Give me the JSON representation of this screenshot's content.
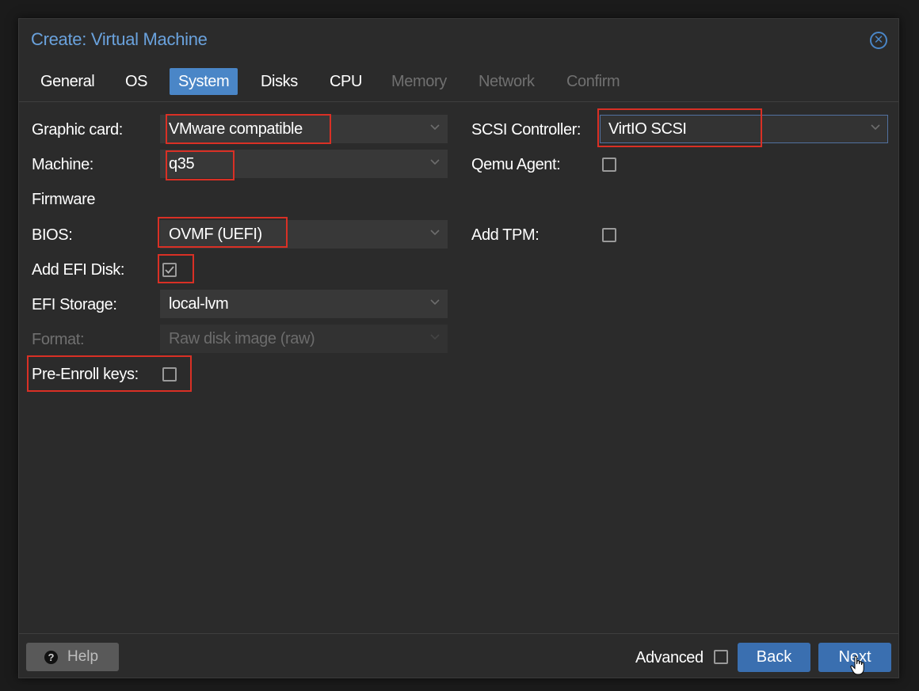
{
  "dialog": {
    "title": "Create: Virtual Machine",
    "close_icon": "close-circle-icon"
  },
  "tabs": [
    {
      "label": "General",
      "state": "enabled"
    },
    {
      "label": "OS",
      "state": "enabled"
    },
    {
      "label": "System",
      "state": "active"
    },
    {
      "label": "Disks",
      "state": "enabled"
    },
    {
      "label": "CPU",
      "state": "enabled"
    },
    {
      "label": "Memory",
      "state": "disabled"
    },
    {
      "label": "Network",
      "state": "disabled"
    },
    {
      "label": "Confirm",
      "state": "disabled"
    }
  ],
  "form": {
    "graphic_card": {
      "label": "Graphic card:",
      "value": "VMware compatible"
    },
    "machine": {
      "label": "Machine:",
      "value": "q35"
    },
    "firmware_heading": "Firmware",
    "bios": {
      "label": "BIOS:",
      "value": "OVMF (UEFI)"
    },
    "add_efi_disk": {
      "label": "Add EFI Disk:",
      "checked": true
    },
    "efi_storage": {
      "label": "EFI Storage:",
      "value": "local-lvm"
    },
    "format": {
      "label": "Format:",
      "value": "Raw disk image (raw)",
      "disabled": true
    },
    "pre_enroll_keys": {
      "label": "Pre-Enroll keys:",
      "checked": false
    },
    "scsi_controller": {
      "label": "SCSI Controller:",
      "value": "VirtIO SCSI"
    },
    "qemu_agent": {
      "label": "Qemu Agent:",
      "checked": false
    },
    "add_tpm": {
      "label": "Add TPM:",
      "checked": false
    }
  },
  "footer": {
    "help_label": "Help",
    "advanced_label": "Advanced",
    "advanced_checked": false,
    "back_label": "Back",
    "next_label": "Next"
  },
  "colors": {
    "accent": "#4a86c7",
    "highlight_box": "#d93025",
    "background": "#2b2b2b"
  }
}
